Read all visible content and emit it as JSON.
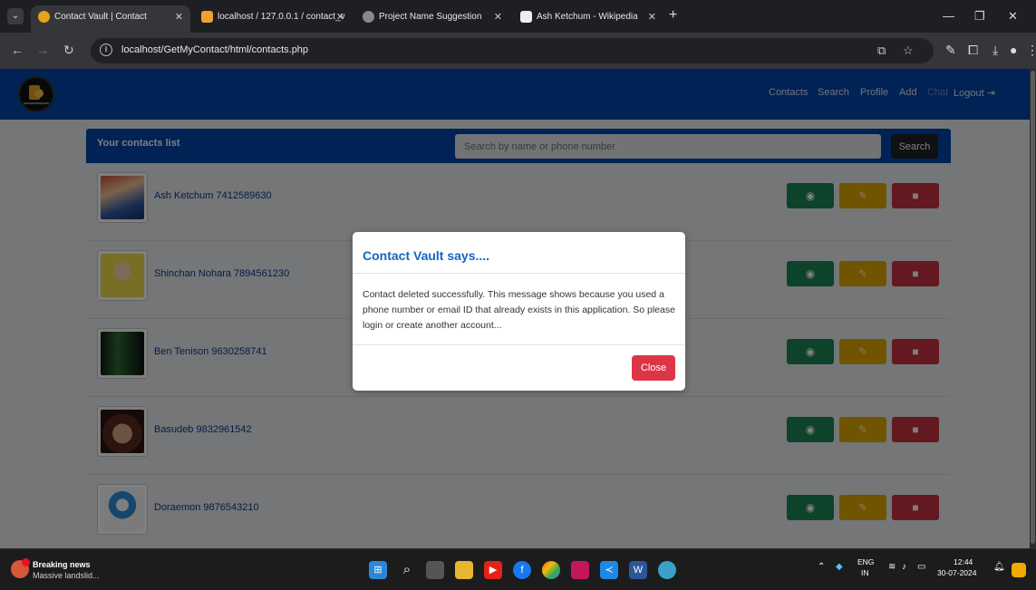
{
  "browser": {
    "tabs": [
      {
        "label": "Contact Vault | Contact",
        "active": true
      },
      {
        "label": "localhost / 127.0.0.1 / contact_v",
        "active": false
      },
      {
        "label": "Project Name Suggestion",
        "active": false
      },
      {
        "label": "Ash Ketchum - Wikipedia",
        "active": false
      }
    ],
    "new_tab": "+",
    "url": "localhost/GetMyContact/html/contacts.php"
  },
  "navbar": {
    "links": [
      "Contacts",
      "Search",
      "Profile",
      "Add",
      "Chat",
      "Logout"
    ]
  },
  "contacts_card": {
    "title": "Your contacts list",
    "search_placeholder": "Search by name or phone number",
    "search_button": "Search",
    "contacts": [
      {
        "name": "Ash Ketchum",
        "phone": "7412589630",
        "display": "Ash Ketchum  7412589630"
      },
      {
        "name": "Shinchan Nohara",
        "phone": "7894561230",
        "display": "Shinchan Nohara  7894561230"
      },
      {
        "name": "Ben Tenison",
        "phone": "9630258741",
        "display": "Ben Tenison  9630258741"
      },
      {
        "name": "Basudeb",
        "phone": "9832961542",
        "display": "Basudeb  9832961542"
      },
      {
        "name": "Doraemon",
        "phone": "9876543210",
        "display": "Doraemon  9876543210"
      }
    ]
  },
  "modal": {
    "title": "Contact Vault says....",
    "message": "Contact deleted successfully. This message shows because you used a phone number or email ID that already exists in this application. So please login or create another account...",
    "close_button": "Close"
  },
  "taskbar": {
    "news_title": "Breaking news",
    "news_subtitle": "Massive landslid...",
    "language": "ENG",
    "region": "IN",
    "time": "12:44",
    "date": "30-07-2024"
  },
  "colors": {
    "navbar": "#0044a8",
    "view": "#198754",
    "edit": "#e0a800",
    "delete": "#c9303f",
    "close": "#dc3545"
  }
}
